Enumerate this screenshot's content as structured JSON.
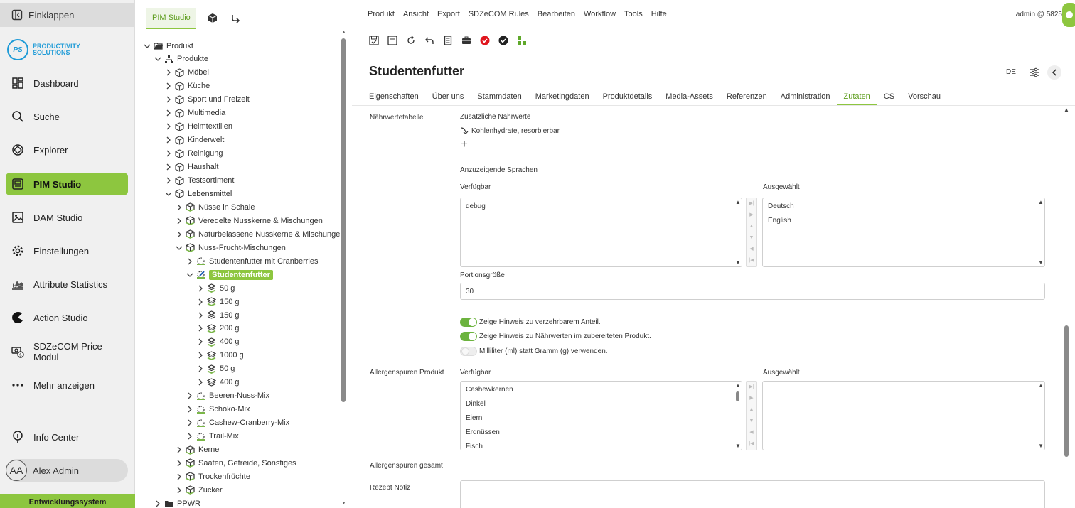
{
  "nav": {
    "collapse_label": "Einklappen",
    "logo_initials": "PS",
    "logo_line1": "PRODUCTIVITY",
    "logo_line2": "SOLUTIONS",
    "items": [
      {
        "label": "Dashboard",
        "icon": "dashboard-icon"
      },
      {
        "label": "Suche",
        "icon": "search-icon"
      },
      {
        "label": "Explorer",
        "icon": "explorer-icon"
      },
      {
        "label": "PIM Studio",
        "icon": "pim-icon",
        "active": true
      },
      {
        "label": "DAM Studio",
        "icon": "image-icon"
      },
      {
        "label": "Einstellungen",
        "icon": "gear-icon"
      },
      {
        "label": "Attribute Statistics",
        "icon": "chart-icon"
      },
      {
        "label": "Action Studio",
        "icon": "action-icon"
      },
      {
        "label": "SDZeCOM Price Modul",
        "icon": "price-icon"
      },
      {
        "label": "Mehr anzeigen",
        "icon": "more-icon"
      },
      {
        "label": "Info Center",
        "icon": "info-icon"
      }
    ],
    "user_initials": "AA",
    "user_name": "Alex Admin",
    "env_label": "Entwicklungssystem"
  },
  "tree": {
    "tab_label": "PIM Studio",
    "rows": [
      {
        "label": "Produkt",
        "level": 0,
        "open": true,
        "icon": "folder-open"
      },
      {
        "label": "Produkte",
        "level": 1,
        "open": true,
        "icon": "hierarchy"
      },
      {
        "label": "Möbel",
        "level": 2,
        "icon": "cube"
      },
      {
        "label": "Küche",
        "level": 2,
        "icon": "cube"
      },
      {
        "label": "Sport und Freizeit",
        "level": 2,
        "icon": "cube"
      },
      {
        "label": "Multimedia",
        "level": 2,
        "icon": "cube"
      },
      {
        "label": "Heimtextilien",
        "level": 2,
        "icon": "cube"
      },
      {
        "label": "Kinderwelt",
        "level": 2,
        "icon": "cube"
      },
      {
        "label": "Reinigung",
        "level": 2,
        "icon": "cube"
      },
      {
        "label": "Haushalt",
        "level": 2,
        "icon": "cube"
      },
      {
        "label": "Testsortiment",
        "level": 2,
        "icon": "cube"
      },
      {
        "label": "Lebensmittel",
        "level": 2,
        "open": true,
        "icon": "cube"
      },
      {
        "label": "Nüsse in Schale",
        "level": 3,
        "icon": "cube-green"
      },
      {
        "label": "Veredelte Nusskerne & Mischungen",
        "level": 3,
        "icon": "cube-green"
      },
      {
        "label": "Naturbelassene Nusskerne & Mischungen",
        "level": 3,
        "icon": "cube-green"
      },
      {
        "label": "Nuss-Frucht-Mischungen",
        "level": 3,
        "open": true,
        "icon": "cube-green"
      },
      {
        "label": "Studentenfutter mit Cranberries",
        "level": 4,
        "icon": "product"
      },
      {
        "label": "Studentenfutter",
        "level": 4,
        "open": true,
        "icon": "product-edit",
        "selected": true
      },
      {
        "label": "50 g",
        "level": 5,
        "icon": "layers-green"
      },
      {
        "label": "150 g",
        "level": 5,
        "icon": "layers-green"
      },
      {
        "label": "150 g",
        "level": 5,
        "icon": "layers"
      },
      {
        "label": "200 g",
        "level": 5,
        "icon": "layers-green"
      },
      {
        "label": "400 g",
        "level": 5,
        "icon": "layers-green"
      },
      {
        "label": "1000 g",
        "level": 5,
        "icon": "layers-green"
      },
      {
        "label": "50 g",
        "level": 5,
        "icon": "layers-green"
      },
      {
        "label": "400 g",
        "level": 5,
        "icon": "layers"
      },
      {
        "label": "Beeren-Nuss-Mix",
        "level": 4,
        "icon": "product"
      },
      {
        "label": "Schoko-Mix",
        "level": 4,
        "icon": "product"
      },
      {
        "label": "Cashew-Cranberry-Mix",
        "level": 4,
        "icon": "product"
      },
      {
        "label": "Trail-Mix",
        "level": 4,
        "icon": "product"
      },
      {
        "label": "Kerne",
        "level": 3,
        "icon": "cube-green"
      },
      {
        "label": "Saaten, Getreide, Sonstiges",
        "level": 3,
        "icon": "cube-green"
      },
      {
        "label": "Trockenfrüchte",
        "level": 3,
        "icon": "cube-green"
      },
      {
        "label": "Zucker",
        "level": 3,
        "icon": "cube-green"
      },
      {
        "label": "PPWR",
        "level": 1,
        "icon": "folder-dark"
      }
    ]
  },
  "menubar": [
    "Produkt",
    "Ansicht",
    "Export",
    "SDZeCOM Rules",
    "Bearbeiten",
    "Workflow",
    "Tools",
    "Hilfe"
  ],
  "user_top": "admin @  5825",
  "title": "Studentenfutter",
  "lang": "DE",
  "tabs": [
    "Eigenschaften",
    "Über uns",
    "Stammdaten",
    "Marketingdaten",
    "Produktdetails",
    "Media-Assets",
    "Referenzen",
    "Administration",
    "Zutaten",
    "CS",
    "Vorschau"
  ],
  "active_tab": "Zutaten",
  "form": {
    "naehrwerttabelle_label": "Nährwertetabelle",
    "zusaetzliche_label": "Zusätzliche Nährwerte",
    "zusaetzliche_item": "Kohlenhydrate, resorbierbar",
    "add_symbol": "+",
    "sprachen_label": "Anzuzeigende Sprachen",
    "verfuegbar_label": "Verfügbar",
    "ausgewaehlt_label": "Ausgewählt",
    "sprachen_available": [
      "debug"
    ],
    "sprachen_selected": [
      "Deutsch",
      "English"
    ],
    "portion_label": "Portionsgröße",
    "portion_value": "30",
    "toggle1": "Zeige Hinweis zu verzehrbarem Anteil.",
    "toggle2": "Zeige Hinweis zu Nährwerten im zubereiteten Produkt.",
    "toggle3": "Milliliter (ml) statt Gramm (g) verwenden.",
    "allergen_label": "Allergenspuren Produkt",
    "allergen_available": [
      "Cashewkernen",
      "Dinkel",
      "Eiern",
      "Erdnüssen",
      "Fisch"
    ],
    "allergen_gesamt_label": "Allergenspuren gesamt",
    "rezept_label": "Rezept Notiz"
  }
}
